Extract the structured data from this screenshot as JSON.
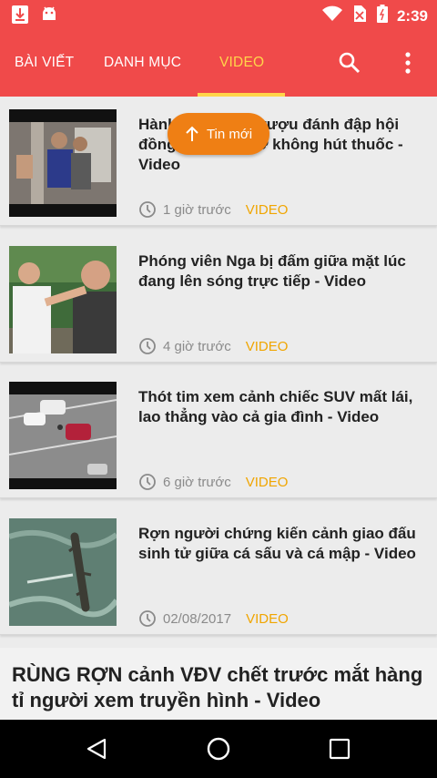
{
  "status_bar": {
    "time": "2:39",
    "left_icons": [
      "download-icon",
      "android-icon"
    ],
    "right_icons": [
      "wifi-icon",
      "no-sim-icon",
      "battery-icon"
    ]
  },
  "appbar": {
    "color": "#f04a4a",
    "accent": "#ffd54a",
    "tabs": [
      {
        "label": "BÀI VIẾT",
        "active": false
      },
      {
        "label": "DANH MỤC",
        "active": false
      },
      {
        "label": "VIDEO",
        "active": true
      }
    ],
    "actions": [
      "search-icon",
      "more-vert-icon"
    ]
  },
  "toast": {
    "label": "Tin mới",
    "icon": "arrow-up-icon",
    "color": "#ef7f14"
  },
  "articles": [
    {
      "title": "Hành khách say rượu đánh đập hội đồng vì nhắc nhở không hút thuốc - Video",
      "time": "1 giờ trước",
      "category": "VIDEO"
    },
    {
      "title": "Phóng viên Nga bị đấm giữa mặt lúc đang lên sóng trực tiếp - Video",
      "time": "4 giờ trước",
      "category": "VIDEO"
    },
    {
      "title": "Thót tim xem cảnh chiếc SUV mất lái, lao thẳng vào cả gia đình - Video",
      "time": "6 giờ trước",
      "category": "VIDEO"
    },
    {
      "title": "Rợn người chứng kiến cảnh giao đấu sinh tử giữa cá sấu và cá mập - Video",
      "time": "02/08/2017",
      "category": "VIDEO"
    }
  ],
  "featured": {
    "title": "RÙNG RỢN cảnh VĐV chết trước mắt hàng tỉ người xem truyền hình - Video"
  },
  "nav_bar": [
    "back-icon",
    "home-icon",
    "recents-icon"
  ]
}
